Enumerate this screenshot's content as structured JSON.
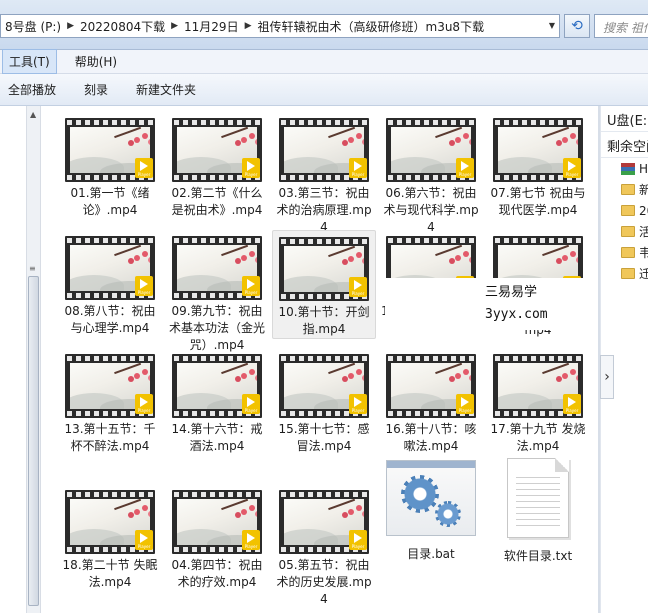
{
  "address": {
    "crumbs": [
      "8号盘 (P:)",
      "20220804下载",
      "11月29日",
      "祖传轩辕祝由术（高级研修班）m3u8下载"
    ],
    "search_placeholder": "搜索 祖传"
  },
  "menu": {
    "tools": "工具(T)",
    "help": "帮助(H)"
  },
  "toolbar": {
    "play_all": "全部播放",
    "burn": "刻录",
    "new_folder": "新建文件夹"
  },
  "files": [
    {
      "name": "01.第一节《绪论》.mp4",
      "type": "video"
    },
    {
      "name": "02.第二节《什么是祝由术》.mp4",
      "type": "video"
    },
    {
      "name": "03.第三节：祝由术的治病原理.mp4",
      "type": "video"
    },
    {
      "name": "06.第六节：祝由术与现代科学.mp4",
      "type": "video"
    },
    {
      "name": "07.第七节 祝由与现代医学.mp4",
      "type": "video"
    },
    {
      "name": "08.第八节：祝由与心理学.mp4",
      "type": "video"
    },
    {
      "name": "09.第九节：祝由术基本功法（金光咒）.mp4",
      "type": "video"
    },
    {
      "name": "10.第十节：开剑指.mp4",
      "type": "video",
      "selected": true
    },
    {
      "name": "1",
      "type": "video"
    },
    {
      "name": "mp4",
      "type": "video"
    },
    {
      "name": "13.第十五节：千杯不醉法.mp4",
      "type": "video"
    },
    {
      "name": "14.第十六节：戒酒法.mp4",
      "type": "video"
    },
    {
      "name": "15.第十七节：感冒法.mp4",
      "type": "video"
    },
    {
      "name": "16.第十八节：咳嗽法.mp4",
      "type": "video"
    },
    {
      "name": "17.第十九节 发烧法.mp4",
      "type": "video"
    },
    {
      "name": "18.第二十节 失眠法.mp4",
      "type": "video"
    },
    {
      "name": "04.第四节：祝由术的疗效.mp4",
      "type": "video"
    },
    {
      "name": "05.第五节：祝由术的历史发展.mp4",
      "type": "video"
    },
    {
      "name": "目录.bat",
      "type": "bat"
    },
    {
      "name": "软件目录.txt",
      "type": "txt"
    }
  ],
  "navpane": {
    "drive": "U盘(E:)",
    "free_space": "剩余空间",
    "items": [
      {
        "icon": "stack-icon",
        "label": "H"
      },
      {
        "icon": "folder-icon",
        "label": "新"
      },
      {
        "icon": "folder-icon",
        "label": "20"
      },
      {
        "icon": "folder-icon",
        "label": "活"
      },
      {
        "icon": "folder-icon",
        "label": "韦"
      },
      {
        "icon": "folder-icon",
        "label": "迁"
      }
    ]
  },
  "watermark": {
    "line1": "三易易学",
    "line2": "3yyx.com"
  }
}
